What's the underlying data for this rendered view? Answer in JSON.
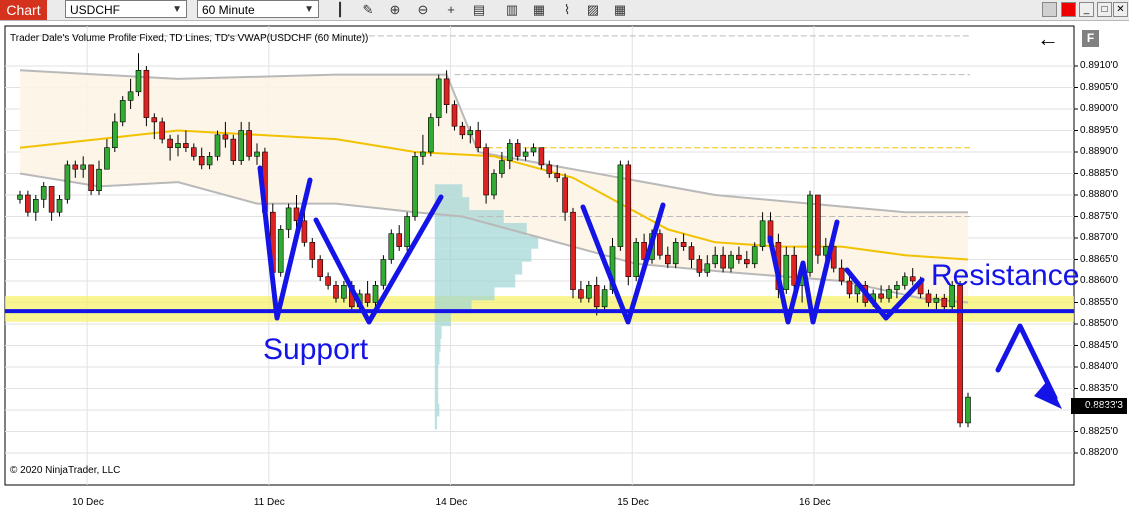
{
  "toolbar": {
    "tab_label": "Chart",
    "instrument": "USDCHF",
    "timeframe": "60 Minute"
  },
  "chart_title": "Trader Dale's Volume Profile Fixed, TD Lines, TD's VWAP(USDCHF (60 Minute))",
  "copyright": "© 2020 NinjaTrader, LLC",
  "f_button": "F",
  "back_arrow": "←",
  "colors": {
    "bull": "#33aa33",
    "bear": "#dd2222",
    "vwap": "#f2c200",
    "bands": "#b9b9b9",
    "zone": "#f7f26e",
    "annotation": "#1414e6",
    "profile": "#9fd4d4"
  },
  "annotations": {
    "support": "Support",
    "resistance": "Resistance"
  },
  "chart_data": {
    "type": "candlestick",
    "symbol": "USDCHF",
    "timeframe": "60 Minute",
    "ylim": [
      0.8818,
      0.8917
    ],
    "y_ticks": [
      "0.8910'0",
      "0.8905'0",
      "0.8900'0",
      "0.8895'0",
      "0.8890'0",
      "0.8885'0",
      "0.8880'0",
      "0.8875'0",
      "0.8870'0",
      "0.8865'0",
      "0.8860'0",
      "0.8855'0",
      "0.8850'0",
      "0.8845'0",
      "0.8840'0",
      "0.8835'0",
      "0.8830'0",
      "0.8825'0",
      "0.8820'0"
    ],
    "x_ticks": [
      "10 Dec",
      "11 Dec",
      "14 Dec",
      "15 Dec",
      "16 Dec"
    ],
    "x_tick_positions": [
      8.5,
      31.5,
      54.5,
      77.5,
      100.5
    ],
    "last_price": "0.8833'3",
    "support_resistance_level": 0.8853,
    "zone": [
      0.88505,
      0.88565
    ],
    "candles": [
      [
        0.8879,
        0.8881,
        0.8878,
        0.888
      ],
      [
        0.888,
        0.8881,
        0.8875,
        0.8876
      ],
      [
        0.8876,
        0.888,
        0.8874,
        0.8879
      ],
      [
        0.8879,
        0.8883,
        0.8877,
        0.8882
      ],
      [
        0.8882,
        0.8882,
        0.8874,
        0.8876
      ],
      [
        0.8876,
        0.888,
        0.8875,
        0.8879
      ],
      [
        0.8879,
        0.8888,
        0.8878,
        0.8887
      ],
      [
        0.8887,
        0.8888,
        0.8884,
        0.8886
      ],
      [
        0.8886,
        0.8889,
        0.8884,
        0.8887
      ],
      [
        0.8887,
        0.8887,
        0.888,
        0.8881
      ],
      [
        0.8881,
        0.8888,
        0.888,
        0.8886
      ],
      [
        0.8886,
        0.8893,
        0.8886,
        0.8891
      ],
      [
        0.8891,
        0.8899,
        0.889,
        0.8897
      ],
      [
        0.8897,
        0.8903,
        0.8896,
        0.8902
      ],
      [
        0.8902,
        0.8907,
        0.89,
        0.8904
      ],
      [
        0.8904,
        0.8913,
        0.8903,
        0.8909
      ],
      [
        0.8909,
        0.891,
        0.8896,
        0.8898
      ],
      [
        0.8898,
        0.8899,
        0.8893,
        0.8897
      ],
      [
        0.8897,
        0.8898,
        0.8892,
        0.8893
      ],
      [
        0.8893,
        0.8894,
        0.8888,
        0.8891
      ],
      [
        0.8891,
        0.8894,
        0.8889,
        0.8892
      ],
      [
        0.8892,
        0.8895,
        0.889,
        0.8891
      ],
      [
        0.8891,
        0.8892,
        0.8888,
        0.8889
      ],
      [
        0.8889,
        0.8891,
        0.8886,
        0.8887
      ],
      [
        0.8887,
        0.889,
        0.8886,
        0.8889
      ],
      [
        0.8889,
        0.8895,
        0.8888,
        0.8894
      ],
      [
        0.8894,
        0.8897,
        0.8891,
        0.8893
      ],
      [
        0.8893,
        0.8894,
        0.8887,
        0.8888
      ],
      [
        0.8888,
        0.8897,
        0.8887,
        0.8895
      ],
      [
        0.8895,
        0.8897,
        0.8888,
        0.8889
      ],
      [
        0.8889,
        0.8892,
        0.8887,
        0.889
      ],
      [
        0.889,
        0.8891,
        0.8874,
        0.8876
      ],
      [
        0.8876,
        0.8878,
        0.886,
        0.8862
      ],
      [
        0.8862,
        0.8873,
        0.8861,
        0.8872
      ],
      [
        0.8872,
        0.8878,
        0.887,
        0.8877
      ],
      [
        0.8877,
        0.888,
        0.8872,
        0.8874
      ],
      [
        0.8874,
        0.8877,
        0.8868,
        0.8869
      ],
      [
        0.8869,
        0.887,
        0.8863,
        0.8865
      ],
      [
        0.8865,
        0.8866,
        0.886,
        0.8861
      ],
      [
        0.8861,
        0.8862,
        0.8858,
        0.8859
      ],
      [
        0.8859,
        0.886,
        0.8855,
        0.8856
      ],
      [
        0.8856,
        0.886,
        0.8855,
        0.8859
      ],
      [
        0.8859,
        0.886,
        0.8853,
        0.8854
      ],
      [
        0.8854,
        0.8858,
        0.8853,
        0.8857
      ],
      [
        0.8857,
        0.886,
        0.8854,
        0.8855
      ],
      [
        0.8855,
        0.886,
        0.8854,
        0.8859
      ],
      [
        0.8859,
        0.8866,
        0.8858,
        0.8865
      ],
      [
        0.8865,
        0.8872,
        0.8864,
        0.8871
      ],
      [
        0.8871,
        0.8873,
        0.8867,
        0.8868
      ],
      [
        0.8868,
        0.8876,
        0.8867,
        0.8875
      ],
      [
        0.8875,
        0.889,
        0.8874,
        0.8889
      ],
      [
        0.8889,
        0.8894,
        0.8887,
        0.889
      ],
      [
        0.889,
        0.8899,
        0.8889,
        0.8898
      ],
      [
        0.8898,
        0.8908,
        0.8896,
        0.8907
      ],
      [
        0.8907,
        0.8909,
        0.8899,
        0.8901
      ],
      [
        0.8901,
        0.8902,
        0.8895,
        0.8896
      ],
      [
        0.8896,
        0.8897,
        0.8893,
        0.8894
      ],
      [
        0.8894,
        0.8896,
        0.8892,
        0.8895
      ],
      [
        0.8895,
        0.8897,
        0.889,
        0.8891
      ],
      [
        0.8891,
        0.8892,
        0.8878,
        0.888
      ],
      [
        0.888,
        0.8886,
        0.8879,
        0.8885
      ],
      [
        0.8885,
        0.889,
        0.8884,
        0.8888
      ],
      [
        0.8888,
        0.8893,
        0.8886,
        0.8892
      ],
      [
        0.8892,
        0.8893,
        0.8888,
        0.8889
      ],
      [
        0.8889,
        0.8891,
        0.8888,
        0.889
      ],
      [
        0.889,
        0.8892,
        0.8889,
        0.8891
      ],
      [
        0.8891,
        0.8891,
        0.8886,
        0.8887
      ],
      [
        0.8887,
        0.8888,
        0.8884,
        0.8885
      ],
      [
        0.8885,
        0.8887,
        0.8883,
        0.8884
      ],
      [
        0.8884,
        0.8885,
        0.8874,
        0.8876
      ],
      [
        0.8876,
        0.8877,
        0.8856,
        0.8858
      ],
      [
        0.8858,
        0.886,
        0.8855,
        0.8856
      ],
      [
        0.8856,
        0.886,
        0.8855,
        0.8859
      ],
      [
        0.8859,
        0.8861,
        0.8852,
        0.8854
      ],
      [
        0.8854,
        0.8859,
        0.8853,
        0.8858
      ],
      [
        0.8858,
        0.887,
        0.8857,
        0.8868
      ],
      [
        0.8868,
        0.8888,
        0.8867,
        0.8887
      ],
      [
        0.8887,
        0.8888,
        0.8859,
        0.8861
      ],
      [
        0.8861,
        0.887,
        0.886,
        0.8869
      ],
      [
        0.8869,
        0.8871,
        0.8863,
        0.8865
      ],
      [
        0.8865,
        0.8872,
        0.8864,
        0.8871
      ],
      [
        0.8871,
        0.8872,
        0.8865,
        0.8866
      ],
      [
        0.8866,
        0.8868,
        0.8863,
        0.8864
      ],
      [
        0.8864,
        0.887,
        0.8863,
        0.8869
      ],
      [
        0.8869,
        0.8871,
        0.8867,
        0.8868
      ],
      [
        0.8868,
        0.8869,
        0.8863,
        0.8865
      ],
      [
        0.8865,
        0.8866,
        0.8861,
        0.8862
      ],
      [
        0.8862,
        0.8866,
        0.8861,
        0.8864
      ],
      [
        0.8864,
        0.8868,
        0.8863,
        0.8866
      ],
      [
        0.8866,
        0.8868,
        0.8862,
        0.8863
      ],
      [
        0.8863,
        0.8867,
        0.8862,
        0.8866
      ],
      [
        0.8866,
        0.8868,
        0.8864,
        0.8865
      ],
      [
        0.8865,
        0.8867,
        0.8863,
        0.8864
      ],
      [
        0.8864,
        0.8869,
        0.8863,
        0.8868
      ],
      [
        0.8868,
        0.8876,
        0.8867,
        0.8874
      ],
      [
        0.8874,
        0.8876,
        0.8868,
        0.8869
      ],
      [
        0.8869,
        0.8871,
        0.8856,
        0.8858
      ],
      [
        0.8858,
        0.8868,
        0.8857,
        0.8866
      ],
      [
        0.8866,
        0.8868,
        0.8857,
        0.8859
      ],
      [
        0.8859,
        0.8864,
        0.8855,
        0.8862
      ],
      [
        0.8862,
        0.8881,
        0.8861,
        0.888
      ],
      [
        0.888,
        0.888,
        0.8864,
        0.8866
      ],
      [
        0.8866,
        0.887,
        0.8863,
        0.8868
      ],
      [
        0.8868,
        0.8869,
        0.8862,
        0.8863
      ],
      [
        0.8863,
        0.8865,
        0.8859,
        0.886
      ],
      [
        0.886,
        0.8861,
        0.8856,
        0.8857
      ],
      [
        0.8857,
        0.886,
        0.8855,
        0.8859
      ],
      [
        0.8859,
        0.886,
        0.8854,
        0.8855
      ],
      [
        0.8855,
        0.8858,
        0.8854,
        0.8857
      ],
      [
        0.8857,
        0.8859,
        0.8855,
        0.8856
      ],
      [
        0.8856,
        0.8859,
        0.8855,
        0.8858
      ],
      [
        0.8858,
        0.886,
        0.8856,
        0.8859
      ],
      [
        0.8859,
        0.8862,
        0.8858,
        0.8861
      ],
      [
        0.8861,
        0.8863,
        0.8859,
        0.886
      ],
      [
        0.886,
        0.8861,
        0.8856,
        0.8857
      ],
      [
        0.8857,
        0.8858,
        0.8854,
        0.8855
      ],
      [
        0.8855,
        0.8857,
        0.8853,
        0.8856
      ],
      [
        0.8856,
        0.8857,
        0.8853,
        0.8854
      ],
      [
        0.8854,
        0.886,
        0.8853,
        0.8859
      ],
      [
        0.8859,
        0.886,
        0.8826,
        0.8827
      ],
      [
        0.8827,
        0.8834,
        0.8826,
        0.8833
      ]
    ],
    "vwap": [
      [
        0,
        0.8891
      ],
      [
        10,
        0.8893
      ],
      [
        20,
        0.8895
      ],
      [
        40,
        0.8893
      ],
      [
        50,
        0.889
      ],
      [
        60,
        0.8889
      ],
      [
        70,
        0.8884
      ],
      [
        76,
        0.8878
      ],
      [
        82,
        0.8872
      ],
      [
        88,
        0.8869
      ],
      [
        96,
        0.8868
      ],
      [
        104,
        0.8868
      ],
      [
        112,
        0.8866
      ],
      [
        120,
        0.8865
      ]
    ],
    "upper_band": [
      [
        0,
        0.8909
      ],
      [
        10,
        0.8908
      ],
      [
        20,
        0.8907
      ],
      [
        40,
        0.8908
      ],
      [
        54,
        0.8908
      ],
      [
        58,
        0.889
      ],
      [
        64,
        0.8888
      ],
      [
        76,
        0.8884
      ],
      [
        88,
        0.888
      ],
      [
        100,
        0.8878
      ],
      [
        112,
        0.8876
      ],
      [
        120,
        0.8876
      ]
    ],
    "lower_band": [
      [
        0,
        0.8885
      ],
      [
        10,
        0.8882
      ],
      [
        20,
        0.8883
      ],
      [
        30,
        0.8878
      ],
      [
        40,
        0.8878
      ],
      [
        50,
        0.8876
      ],
      [
        56,
        0.8875
      ],
      [
        66,
        0.887
      ],
      [
        78,
        0.8864
      ],
      [
        90,
        0.8862
      ],
      [
        104,
        0.886
      ],
      [
        114,
        0.8856
      ],
      [
        120,
        0.8855
      ]
    ],
    "volume_profile": [
      [
        0.8881,
        1.2
      ],
      [
        0.8878,
        1.5
      ],
      [
        0.8875,
        3.0
      ],
      [
        0.8872,
        4.0
      ],
      [
        0.8869,
        4.5
      ],
      [
        0.8866,
        4.2
      ],
      [
        0.8863,
        3.8
      ],
      [
        0.886,
        3.5
      ],
      [
        0.8857,
        2.6
      ],
      [
        0.8854,
        1.6
      ],
      [
        0.8851,
        0.7
      ],
      [
        0.8848,
        0.3
      ],
      [
        0.8845,
        0.25
      ],
      [
        0.8842,
        0.2
      ],
      [
        0.8839,
        0.15
      ],
      [
        0.8836,
        0.15
      ],
      [
        0.8833,
        0.15
      ],
      [
        0.883,
        0.2
      ],
      [
        0.8827,
        0.1
      ]
    ]
  }
}
